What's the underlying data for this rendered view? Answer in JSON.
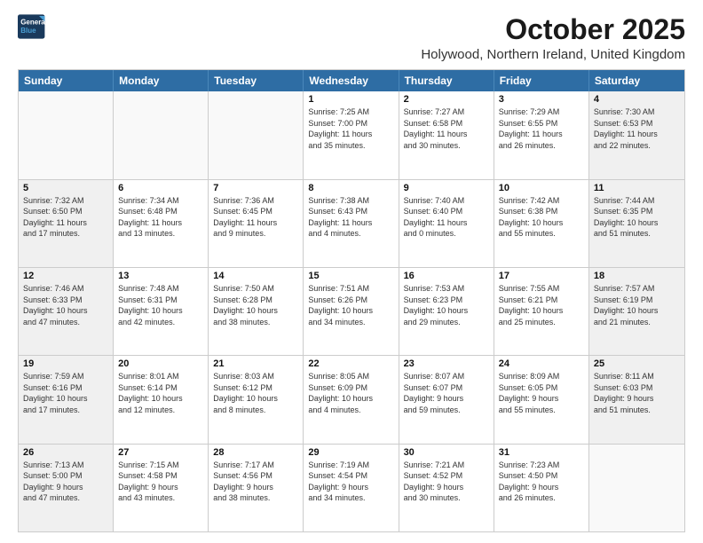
{
  "logo": {
    "line1": "General",
    "line2": "Blue"
  },
  "title": "October 2025",
  "subtitle": "Holywood, Northern Ireland, United Kingdom",
  "header_days": [
    "Sunday",
    "Monday",
    "Tuesday",
    "Wednesday",
    "Thursday",
    "Friday",
    "Saturday"
  ],
  "weeks": [
    [
      {
        "day": "",
        "text": "",
        "empty": true
      },
      {
        "day": "",
        "text": "",
        "empty": true
      },
      {
        "day": "",
        "text": "",
        "empty": true
      },
      {
        "day": "1",
        "text": "Sunrise: 7:25 AM\nSunset: 7:00 PM\nDaylight: 11 hours\nand 35 minutes.",
        "empty": false
      },
      {
        "day": "2",
        "text": "Sunrise: 7:27 AM\nSunset: 6:58 PM\nDaylight: 11 hours\nand 30 minutes.",
        "empty": false
      },
      {
        "day": "3",
        "text": "Sunrise: 7:29 AM\nSunset: 6:55 PM\nDaylight: 11 hours\nand 26 minutes.",
        "empty": false
      },
      {
        "day": "4",
        "text": "Sunrise: 7:30 AM\nSunset: 6:53 PM\nDaylight: 11 hours\nand 22 minutes.",
        "empty": false,
        "shaded": true
      }
    ],
    [
      {
        "day": "5",
        "text": "Sunrise: 7:32 AM\nSunset: 6:50 PM\nDaylight: 11 hours\nand 17 minutes.",
        "empty": false,
        "shaded": true
      },
      {
        "day": "6",
        "text": "Sunrise: 7:34 AM\nSunset: 6:48 PM\nDaylight: 11 hours\nand 13 minutes.",
        "empty": false
      },
      {
        "day": "7",
        "text": "Sunrise: 7:36 AM\nSunset: 6:45 PM\nDaylight: 11 hours\nand 9 minutes.",
        "empty": false
      },
      {
        "day": "8",
        "text": "Sunrise: 7:38 AM\nSunset: 6:43 PM\nDaylight: 11 hours\nand 4 minutes.",
        "empty": false
      },
      {
        "day": "9",
        "text": "Sunrise: 7:40 AM\nSunset: 6:40 PM\nDaylight: 11 hours\nand 0 minutes.",
        "empty": false
      },
      {
        "day": "10",
        "text": "Sunrise: 7:42 AM\nSunset: 6:38 PM\nDaylight: 10 hours\nand 55 minutes.",
        "empty": false
      },
      {
        "day": "11",
        "text": "Sunrise: 7:44 AM\nSunset: 6:35 PM\nDaylight: 10 hours\nand 51 minutes.",
        "empty": false,
        "shaded": true
      }
    ],
    [
      {
        "day": "12",
        "text": "Sunrise: 7:46 AM\nSunset: 6:33 PM\nDaylight: 10 hours\nand 47 minutes.",
        "empty": false,
        "shaded": true
      },
      {
        "day": "13",
        "text": "Sunrise: 7:48 AM\nSunset: 6:31 PM\nDaylight: 10 hours\nand 42 minutes.",
        "empty": false
      },
      {
        "day": "14",
        "text": "Sunrise: 7:50 AM\nSunset: 6:28 PM\nDaylight: 10 hours\nand 38 minutes.",
        "empty": false
      },
      {
        "day": "15",
        "text": "Sunrise: 7:51 AM\nSunset: 6:26 PM\nDaylight: 10 hours\nand 34 minutes.",
        "empty": false
      },
      {
        "day": "16",
        "text": "Sunrise: 7:53 AM\nSunset: 6:23 PM\nDaylight: 10 hours\nand 29 minutes.",
        "empty": false
      },
      {
        "day": "17",
        "text": "Sunrise: 7:55 AM\nSunset: 6:21 PM\nDaylight: 10 hours\nand 25 minutes.",
        "empty": false
      },
      {
        "day": "18",
        "text": "Sunrise: 7:57 AM\nSunset: 6:19 PM\nDaylight: 10 hours\nand 21 minutes.",
        "empty": false,
        "shaded": true
      }
    ],
    [
      {
        "day": "19",
        "text": "Sunrise: 7:59 AM\nSunset: 6:16 PM\nDaylight: 10 hours\nand 17 minutes.",
        "empty": false,
        "shaded": true
      },
      {
        "day": "20",
        "text": "Sunrise: 8:01 AM\nSunset: 6:14 PM\nDaylight: 10 hours\nand 12 minutes.",
        "empty": false
      },
      {
        "day": "21",
        "text": "Sunrise: 8:03 AM\nSunset: 6:12 PM\nDaylight: 10 hours\nand 8 minutes.",
        "empty": false
      },
      {
        "day": "22",
        "text": "Sunrise: 8:05 AM\nSunset: 6:09 PM\nDaylight: 10 hours\nand 4 minutes.",
        "empty": false
      },
      {
        "day": "23",
        "text": "Sunrise: 8:07 AM\nSunset: 6:07 PM\nDaylight: 9 hours\nand 59 minutes.",
        "empty": false
      },
      {
        "day": "24",
        "text": "Sunrise: 8:09 AM\nSunset: 6:05 PM\nDaylight: 9 hours\nand 55 minutes.",
        "empty": false
      },
      {
        "day": "25",
        "text": "Sunrise: 8:11 AM\nSunset: 6:03 PM\nDaylight: 9 hours\nand 51 minutes.",
        "empty": false,
        "shaded": true
      }
    ],
    [
      {
        "day": "26",
        "text": "Sunrise: 7:13 AM\nSunset: 5:00 PM\nDaylight: 9 hours\nand 47 minutes.",
        "empty": false,
        "shaded": true
      },
      {
        "day": "27",
        "text": "Sunrise: 7:15 AM\nSunset: 4:58 PM\nDaylight: 9 hours\nand 43 minutes.",
        "empty": false
      },
      {
        "day": "28",
        "text": "Sunrise: 7:17 AM\nSunset: 4:56 PM\nDaylight: 9 hours\nand 38 minutes.",
        "empty": false
      },
      {
        "day": "29",
        "text": "Sunrise: 7:19 AM\nSunset: 4:54 PM\nDaylight: 9 hours\nand 34 minutes.",
        "empty": false
      },
      {
        "day": "30",
        "text": "Sunrise: 7:21 AM\nSunset: 4:52 PM\nDaylight: 9 hours\nand 30 minutes.",
        "empty": false
      },
      {
        "day": "31",
        "text": "Sunrise: 7:23 AM\nSunset: 4:50 PM\nDaylight: 9 hours\nand 26 minutes.",
        "empty": false
      },
      {
        "day": "",
        "text": "",
        "empty": true,
        "shaded": true
      }
    ]
  ]
}
